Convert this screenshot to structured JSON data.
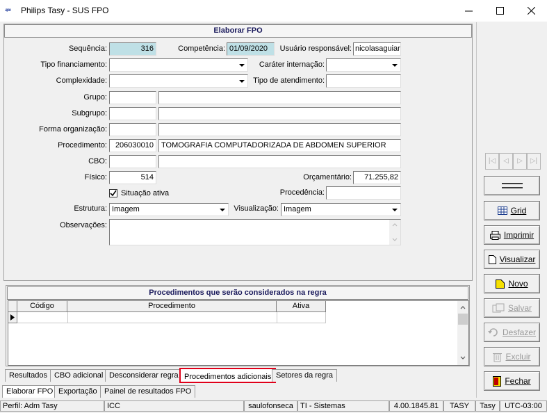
{
  "window": {
    "title": "Philips Tasy - SUS FPO",
    "logo_text": "TASY"
  },
  "form": {
    "header": "Elaborar FPO",
    "sequencia_label": "Sequência:",
    "sequencia_value": "316",
    "competencia_label": "Competência:",
    "competencia_value": "01/09/2020",
    "usuario_label": "Usuário responsável:",
    "usuario_value": "nicolasaguiar",
    "tipo_financiamento_label": "Tipo financiamento:",
    "tipo_financiamento_value": "",
    "carater_label": "Caráter internação:",
    "carater_value": "",
    "complexidade_label": "Complexidade:",
    "complexidade_value": "",
    "tipo_atendimento_label": "Tipo de atendimento:",
    "tipo_atendimento_value": "",
    "grupo_label": "Grupo:",
    "subgrupo_label": "Subgrupo:",
    "forma_label": "Forma organização:",
    "procedimento_label": "Procedimento:",
    "procedimento_code": "206030010",
    "procedimento_desc": "TOMOGRAFIA COMPUTADORIZADA DE ABDOMEN SUPERIOR",
    "cbo_label": "CBO:",
    "fisico_label": "Físico:",
    "fisico_value": "514",
    "orcamentario_label": "Orçamentário:",
    "orcamentario_value": "71.255,82",
    "situacao_label": "Situação ativa",
    "situacao_checked": true,
    "procedencia_label": "Procedência:",
    "estrutura_label": "Estrutura:",
    "estrutura_value": "Imagem",
    "visualizacao_label": "Visualização:",
    "visualizacao_value": "Imagem",
    "observacoes_label": "Observações:"
  },
  "grid": {
    "header": "Procedimentos que serão considerados na regra",
    "columns": [
      "Código",
      "Procedimento",
      "Ativa"
    ]
  },
  "inner_tabs": [
    "Resultados",
    "CBO adicional",
    "Desconsiderar regra",
    "Procedimentos adicionais",
    "Setores da regra"
  ],
  "outer_tabs": [
    "Elaborar FPO",
    "Exportação",
    "Painel de resultados FPO"
  ],
  "side_buttons": {
    "grid": "Grid",
    "imprimir": "Imprimir",
    "visualizar": "Visualizar",
    "novo": "Novo",
    "salvar": "Salvar",
    "desfazer": "Desfazer",
    "excluir": "Excluir",
    "fechar": "Fechar"
  },
  "status_bar": {
    "perfil": "Perfil: Adm Tasy",
    "icc": "ICC",
    "user": "saulofonseca",
    "setor": "TI - Sistemas",
    "version": "4.00.1845.81",
    "tasy1": "TASY",
    "tasy2": "Tasy",
    "tz": "UTC-03:00"
  },
  "colors": {
    "readonly_field": "#bfe0e6",
    "highlight_red": "#e0001a",
    "novo_icon": "#f5e000",
    "fechar_icon": "#c00000"
  }
}
